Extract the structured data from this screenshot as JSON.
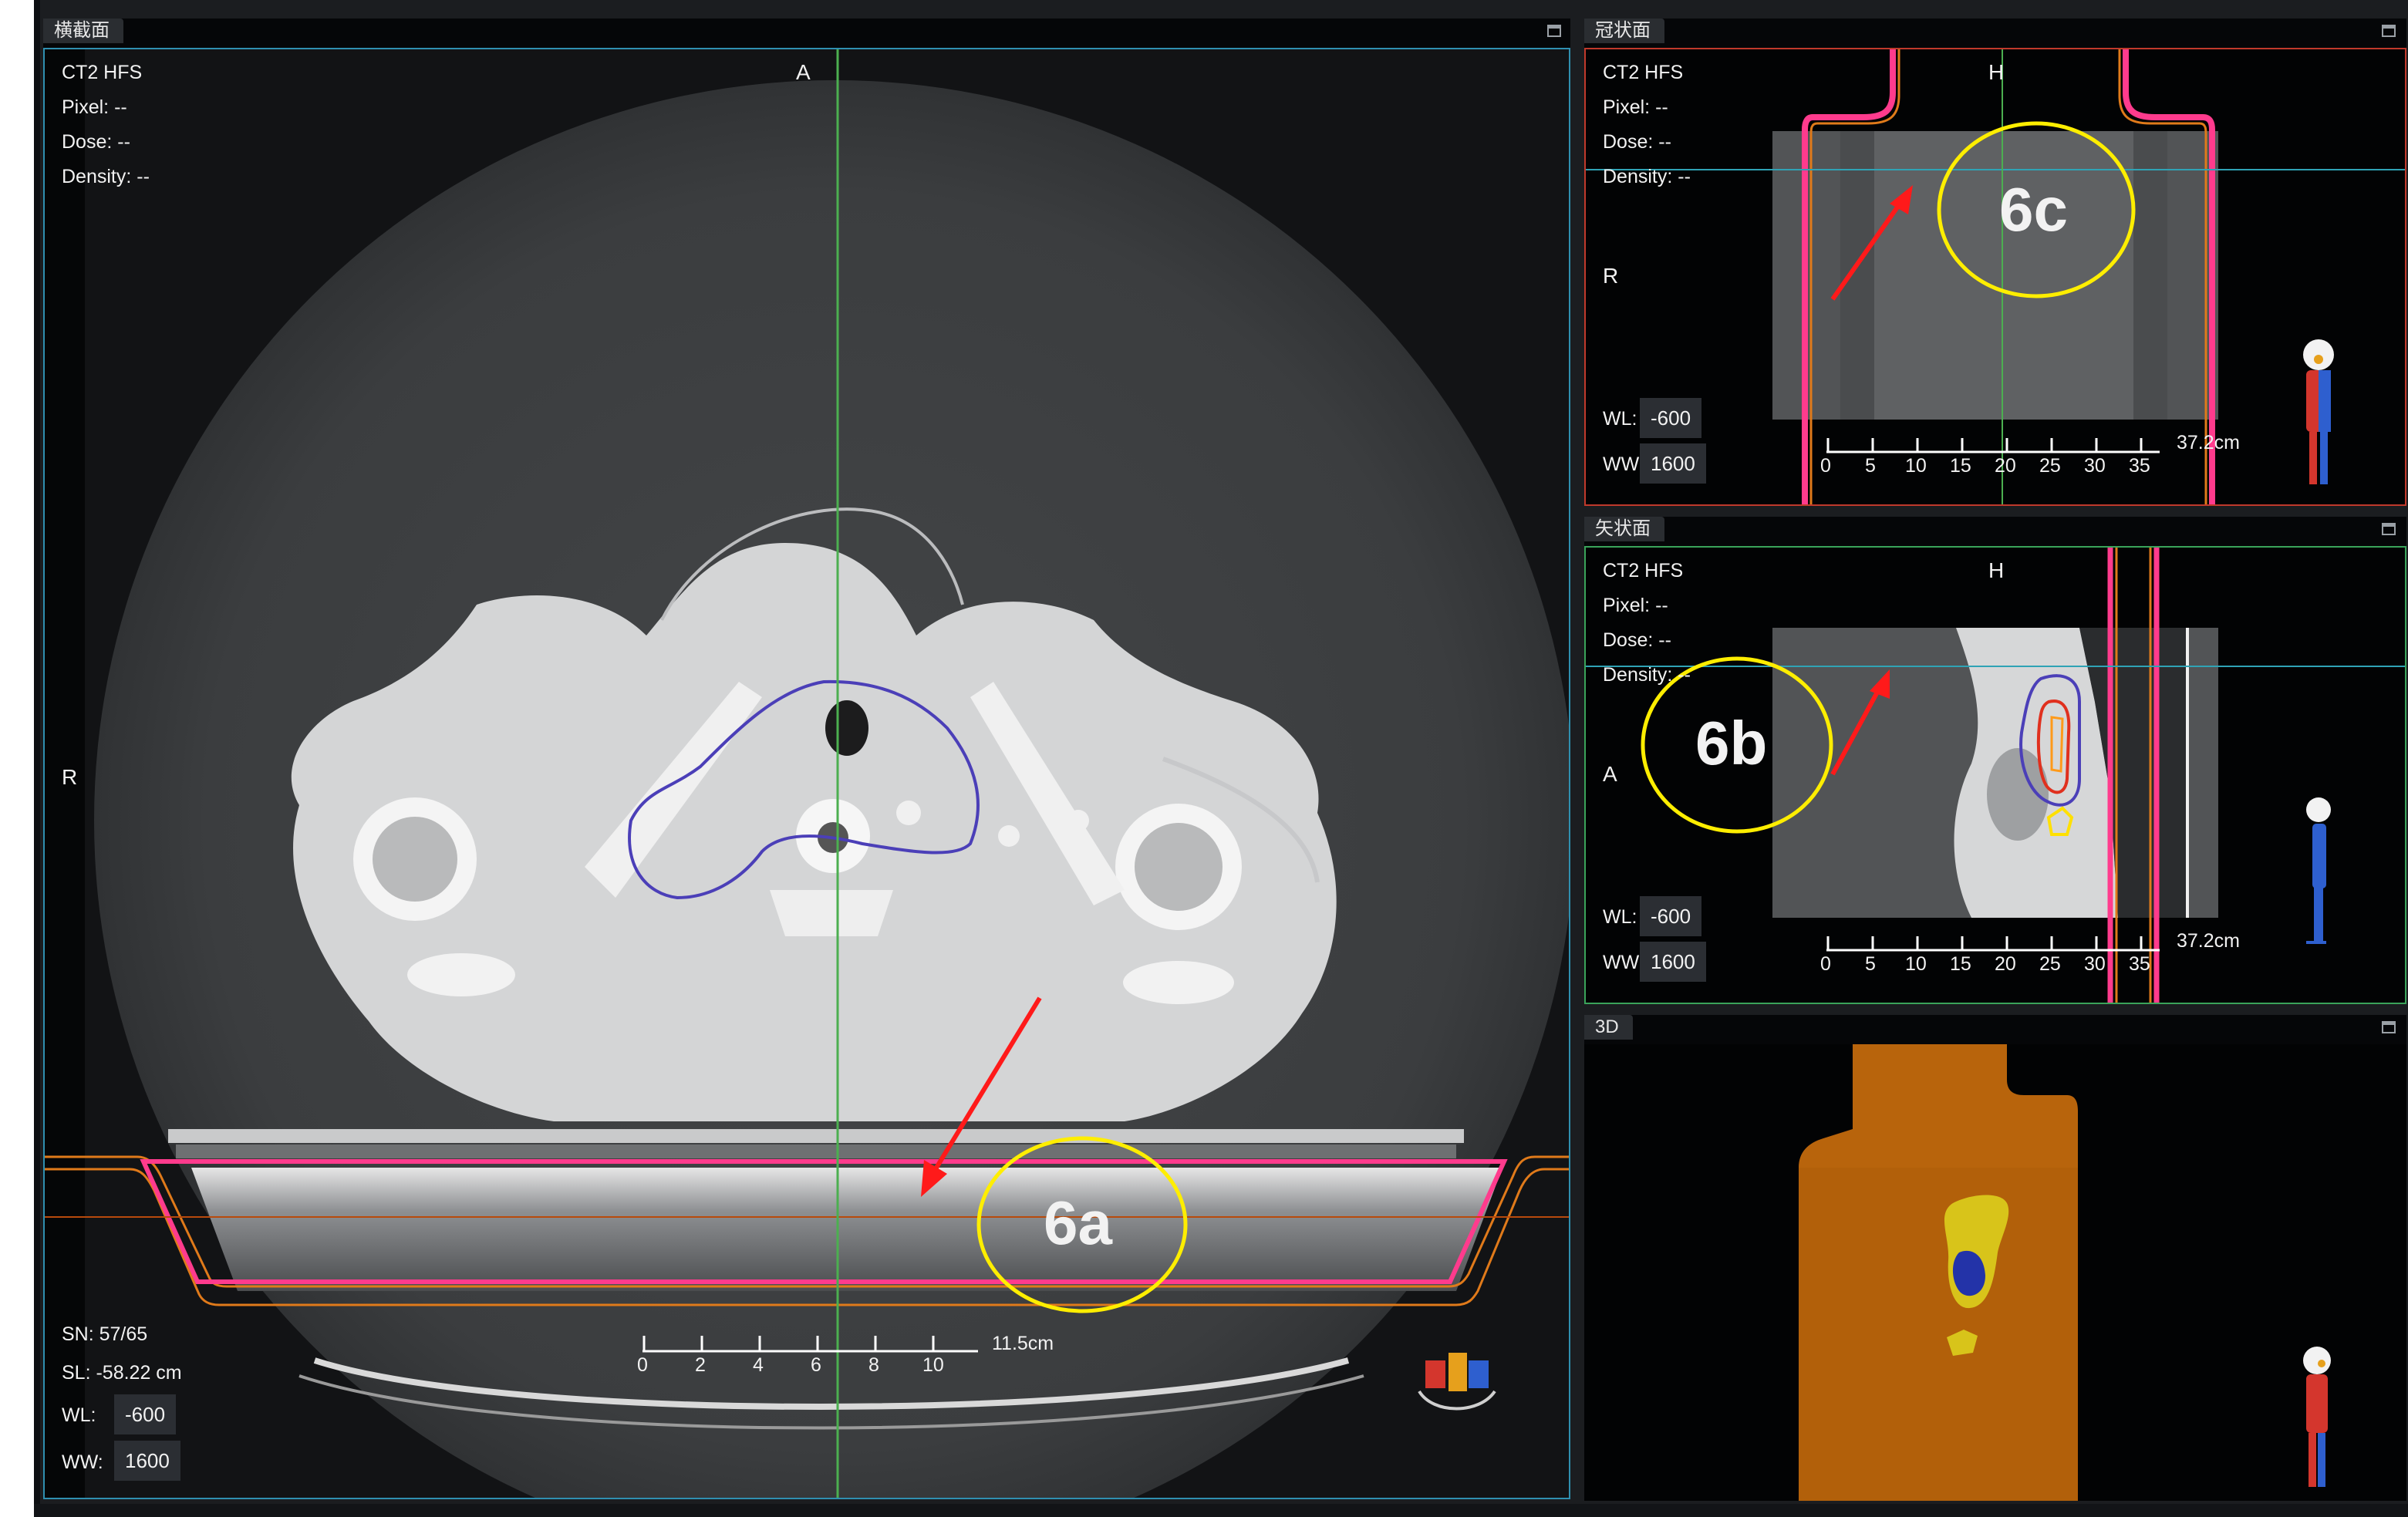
{
  "panels": {
    "axial": {
      "title": "横截面",
      "series": "CT2 HFS",
      "pixel": "Pixel:  --",
      "dose": "Dose:  --",
      "density": "Density:  --",
      "orient_top": "A",
      "orient_left": "R",
      "sn": "SN: 57/65",
      "sl": "SL: -58.22 cm",
      "wl_label": "WL:",
      "wl_value": "-600",
      "ww_label": "WW:",
      "ww_value": "1600",
      "scale_ticks": [
        "0",
        "2",
        "4",
        "6",
        "8",
        "10"
      ],
      "scale_label": "11.5cm",
      "annotation": "6a"
    },
    "coronal": {
      "title": "冠状面",
      "series": "CT2 HFS",
      "pixel": "Pixel:  --",
      "dose": "Dose:  --",
      "density": "Density:  --",
      "orient_top": "H",
      "orient_left": "R",
      "wl_label": "WL:",
      "wl_value": "-600",
      "ww_label": "WW:",
      "ww_value": "1600",
      "scale_ticks": [
        "0",
        "5",
        "10",
        "15",
        "20",
        "25",
        "30",
        "35"
      ],
      "scale_label": "37.2cm",
      "annotation": "6c"
    },
    "sagittal": {
      "title": "矢状面",
      "series": "CT2 HFS",
      "pixel": "Pixel:  --",
      "dose": "Dose:  --",
      "density": "Density:  --",
      "orient_top": "H",
      "orient_left": "A",
      "wl_label": "WL:",
      "wl_value": "-600",
      "ww_label": "WW:",
      "ww_value": "1600",
      "scale_ticks": [
        "0",
        "5",
        "10",
        "15",
        "20",
        "25",
        "30",
        "35"
      ],
      "scale_label": "37.2cm",
      "annotation": "6b"
    },
    "three_d": {
      "title": "3D"
    }
  },
  "colors": {
    "axial_border": "#2f8fb0",
    "coronal_border": "#c0392b",
    "sagittal_border": "#3aa35a",
    "crosshair": "#4caf50",
    "couch_outline": "#ff3b8d",
    "annotation_circle": "#ffee00",
    "annotation_arrow": "#ff1a1a",
    "roi_contour": "#4b3fb8",
    "body_3d": "#b8640c"
  },
  "icons": [
    "maximize-icon",
    "orientation-cube-icon",
    "patient-figure-icon"
  ]
}
